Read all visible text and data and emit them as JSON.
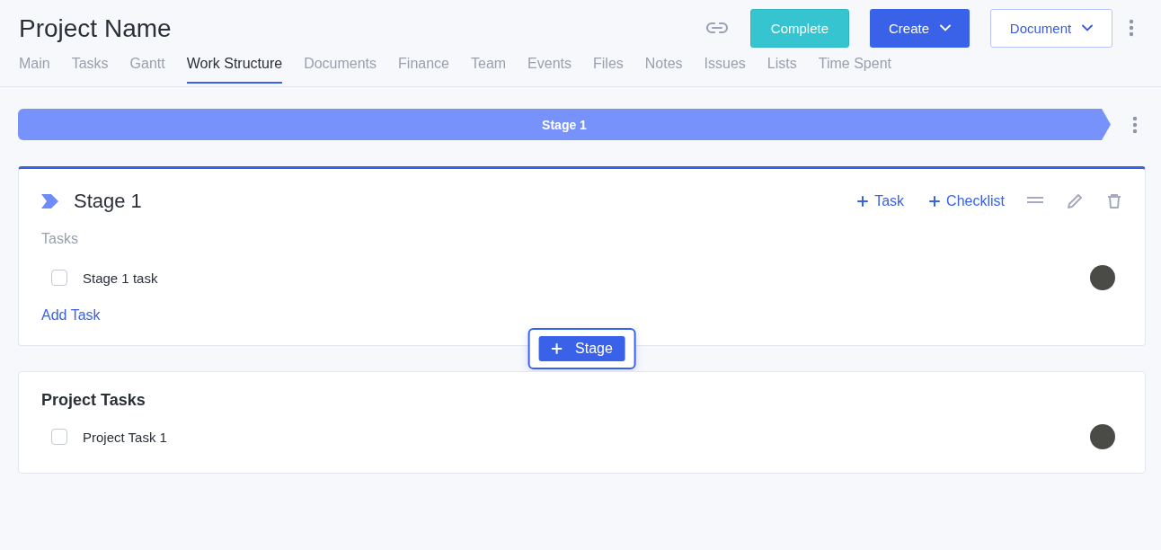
{
  "header": {
    "title": "Project Name",
    "buttons": [
      {
        "label": "Complete",
        "kind": "success",
        "dropdown": false
      },
      {
        "label": "Create",
        "kind": "primary",
        "dropdown": true
      },
      {
        "label": "Document",
        "kind": "outline",
        "dropdown": true
      }
    ]
  },
  "tabs": [
    {
      "label": "Main",
      "selected": false
    },
    {
      "label": "Tasks",
      "selected": false
    },
    {
      "label": "Gantt",
      "selected": false
    },
    {
      "label": "Work Structure",
      "selected": true
    },
    {
      "label": "Documents",
      "selected": false
    },
    {
      "label": "Finance",
      "selected": false
    },
    {
      "label": "Team",
      "selected": false
    },
    {
      "label": "Events",
      "selected": false
    },
    {
      "label": "Files",
      "selected": false
    },
    {
      "label": "Notes",
      "selected": false
    },
    {
      "label": "Issues",
      "selected": false
    },
    {
      "label": "Lists",
      "selected": false
    },
    {
      "label": "Time Spent",
      "selected": false
    }
  ],
  "stage_bar": {
    "label": "Stage 1"
  },
  "stage": {
    "title": "Stage 1",
    "actions": [
      "Task",
      "Checklist"
    ],
    "section_label": "Tasks",
    "tasks": [
      {
        "name": "Stage 1 task",
        "checked": false
      }
    ],
    "add_link": "Add Task"
  },
  "add_stage_button": "Stage",
  "project_tasks": {
    "title": "Project Tasks",
    "tasks": [
      {
        "name": "Project Task 1",
        "checked": false
      }
    ]
  }
}
